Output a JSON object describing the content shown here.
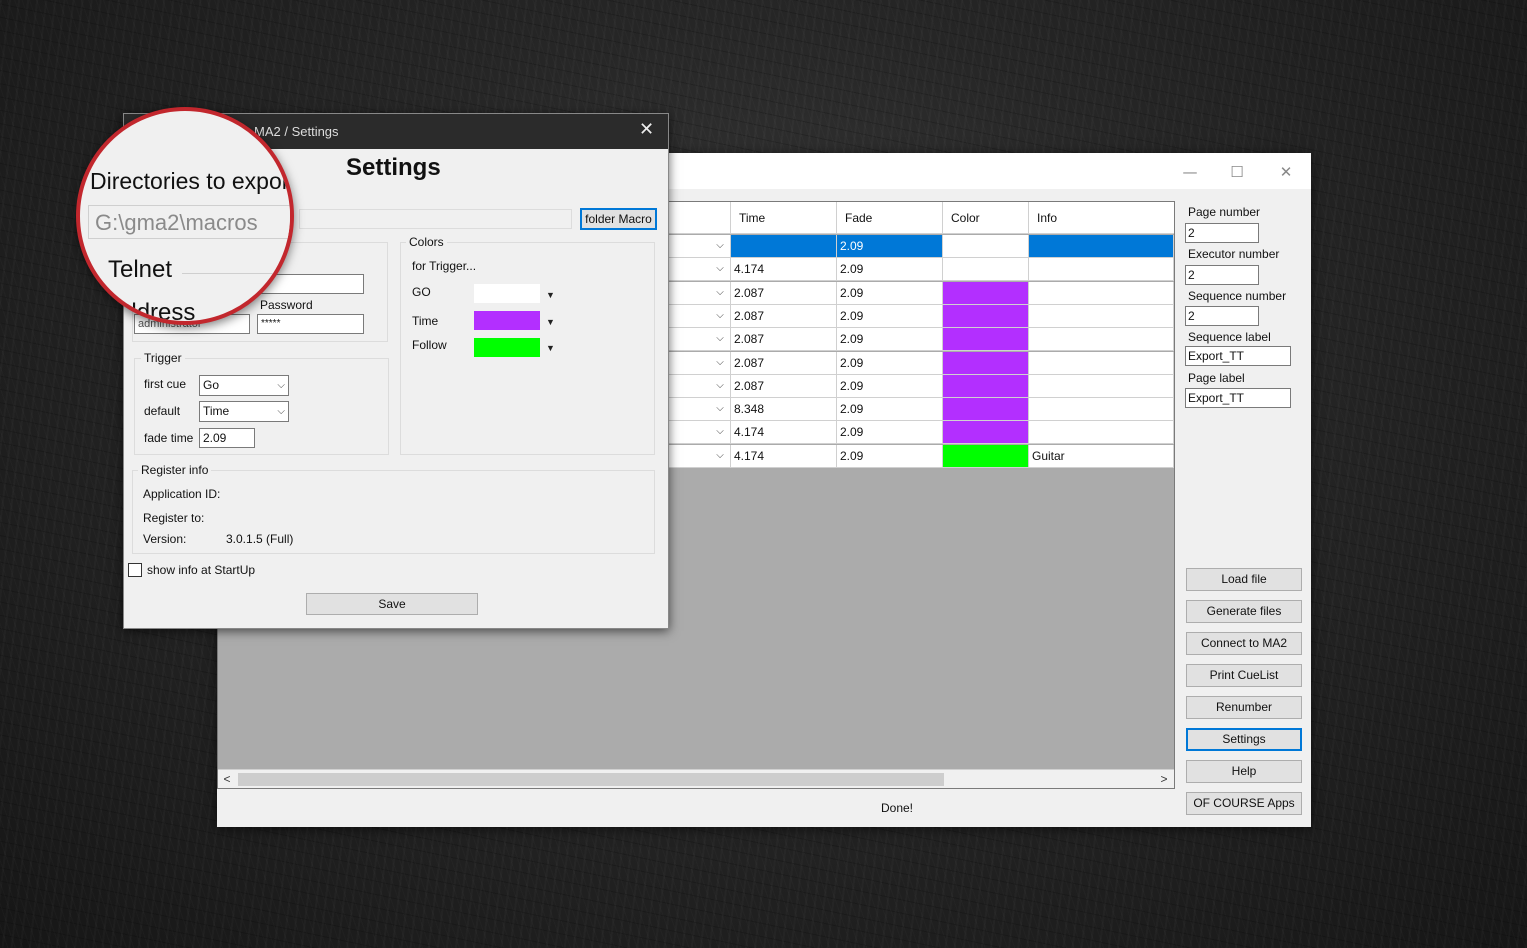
{
  "main_window": {
    "title_controls": {
      "minimize": "—",
      "maximize": "☐",
      "close": "✕"
    },
    "grid": {
      "headers": [
        "Time",
        "Fade",
        "Color",
        "Info"
      ],
      "rows": [
        {
          "time": "",
          "fade": "2.09",
          "color": "#ffffff",
          "info": "",
          "selected": true
        },
        {
          "time": "4.174",
          "fade": "2.09",
          "color": "#ffffff",
          "info": ""
        },
        {
          "time": "2.087",
          "fade": "2.09",
          "color": "#b32fff",
          "info": ""
        },
        {
          "time": "2.087",
          "fade": "2.09",
          "color": "#b32fff",
          "info": ""
        },
        {
          "time": "2.087",
          "fade": "2.09",
          "color": "#b32fff",
          "info": ""
        },
        {
          "time": "2.087",
          "fade": "2.09",
          "color": "#b32fff",
          "info": ""
        },
        {
          "time": "2.087",
          "fade": "2.09",
          "color": "#b32fff",
          "info": ""
        },
        {
          "time": "8.348",
          "fade": "2.09",
          "color": "#b32fff",
          "info": ""
        },
        {
          "time": "4.174",
          "fade": "2.09",
          "color": "#b32fff",
          "info": ""
        },
        {
          "time": "4.174",
          "fade": "2.09",
          "color": "#00ff00",
          "info": "Guitar"
        }
      ],
      "selection_color": "#0078d7",
      "scroll_left": "<",
      "scroll_right": ">"
    },
    "status": "Done!",
    "right_panel": {
      "page_number_label": "Page number",
      "page_number": "2",
      "executor_number_label": "Executor number",
      "executor_number": "2",
      "sequence_number_label": "Sequence number",
      "sequence_number": "2",
      "sequence_label_label": "Sequence label",
      "sequence_label": "Export_TT",
      "page_label_label": "Page label",
      "page_label": "Export_TT",
      "buttons": {
        "load_file": "Load file",
        "generate_files": "Generate files",
        "connect": "Connect to MA2",
        "print_cuelist": "Print CueList",
        "renumber": "Renumber",
        "settings": "Settings",
        "help": "Help",
        "of_course_apps": "OF COURSE Apps"
      }
    }
  },
  "settings_dialog": {
    "title": "MA2 / Settings",
    "close_icon": "✕",
    "heading": "Settings",
    "directories_label": "Directories to export",
    "directory_value": "G:\\gma2\\macros",
    "folder_button": "folder Macro",
    "telnet_label": "Telnet",
    "ip_address_label": "address",
    "username_value": "administrator",
    "password_label": "Password",
    "password_value": "*****",
    "trigger": {
      "title": "Trigger",
      "first_cue_label": "first cue",
      "first_cue_value": "Go",
      "default_label": "default",
      "default_value": "Time",
      "fade_time_label": "fade time",
      "fade_time_value": "2.09"
    },
    "colors": {
      "title": "Colors",
      "for_trigger_label": "for Trigger...",
      "go_label": "GO",
      "go_color": "#ffffff",
      "time_label": "Time",
      "time_color": "#b32fff",
      "follow_label": "Follow",
      "follow_color": "#00ff00",
      "dropdown_arrow": "▼"
    },
    "register_info": {
      "title": "Register info",
      "application_id_label": "Application ID:",
      "register_to_label": "Register to:",
      "version_label": "Version:",
      "version_value": "3.0.1.5 (Full)"
    },
    "show_info_label": "show info at StartUp",
    "save_button": "Save"
  },
  "icons": {
    "dropdown": "chevron-down-icon",
    "close": "close-icon"
  },
  "accent_color": "#0078d7",
  "magnifier_color": "#c2272d"
}
